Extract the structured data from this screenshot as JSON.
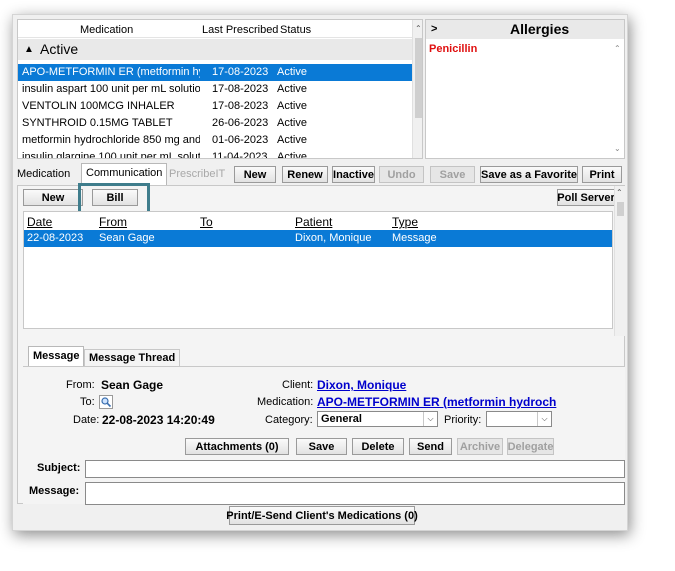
{
  "med_list": {
    "columns": [
      "Medication",
      "Last Prescribed",
      "Status"
    ],
    "group_label": "Active",
    "rows": [
      {
        "name": "APO-METFORMIN ER (metformin hyd",
        "date": "17-08-2023",
        "status": "Active",
        "selected": true
      },
      {
        "name": "insulin aspart 100 unit per mL solutio",
        "date": "17-08-2023",
        "status": "Active"
      },
      {
        "name": "VENTOLIN 100MCG INHALER",
        "date": "17-08-2023",
        "status": "Active"
      },
      {
        "name": "SYNTHROID 0.15MG TABLET",
        "date": "26-06-2023",
        "status": "Active"
      },
      {
        "name": "metformin hydrochloride 850 mg and",
        "date": "01-06-2023",
        "status": "Active"
      },
      {
        "name": "insulin glargine 100 unit per mL solut",
        "date": "11-04-2023",
        "status": "Active"
      }
    ]
  },
  "allergies": {
    "toggle": ">",
    "title": "Allergies",
    "items": [
      "Penicillin"
    ]
  },
  "tabs": {
    "medication": "Medication",
    "communication": "Communication",
    "prescribeit": "PrescribeIT"
  },
  "toolbar": {
    "new": "New",
    "renew": "Renew",
    "inactive": "Inactive",
    "undo": "Undo",
    "save": "Save",
    "save_favorite": "Save as a Favorite",
    "print": "Print"
  },
  "comm": {
    "new": "New",
    "bill": "Bill",
    "poll_server": "Poll Server",
    "columns": [
      "Date",
      "From",
      "To",
      "Patient",
      "Type"
    ],
    "rows": [
      {
        "date": "22-08-2023",
        "from": "Sean Gage",
        "to": "",
        "patient": "Dixon, Monique",
        "type": "Message"
      }
    ]
  },
  "detail": {
    "tab_message": "Message",
    "tab_thread": "Message Thread",
    "from_label": "From:",
    "from_value": "Sean Gage",
    "to_label": "To:",
    "date_label": "Date:",
    "date_value": "22-08-2023 14:20:49",
    "client_label": "Client:",
    "client_value": "Dixon, Monique",
    "medication_label": "Medication:",
    "medication_value": "APO-METFORMIN ER (metformin hydroch",
    "category_label": "Category:",
    "category_value": "General",
    "priority_label": "Priority:",
    "priority_value": "",
    "buttons": {
      "attachments": "Attachments (0)",
      "save": "Save",
      "delete": "Delete",
      "send": "Send",
      "archive": "Archive",
      "delegate": "Delegate"
    },
    "subject_label": "Subject:",
    "subject_value": "",
    "message_label": "Message:",
    "message_value": ""
  },
  "footer": {
    "print_send": "Print/E-Send Client's Medications (0)"
  },
  "colors": {
    "selection": "#0a7ad6",
    "highlight_box": "#3f7d8c",
    "allergy_text": "#e01010",
    "link": "#0000cc"
  }
}
